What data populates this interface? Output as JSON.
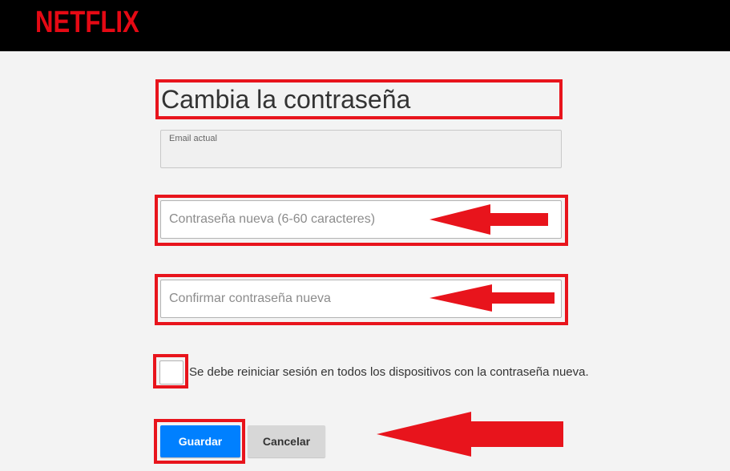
{
  "header": {
    "logo_text": "NETFLIX",
    "brand_color": "#e50914"
  },
  "form": {
    "title": "Cambia la contraseña",
    "email_label": "Email actual",
    "new_password_placeholder": "Contraseña nueva (6-60 caracteres)",
    "confirm_password_placeholder": "Confirmar contraseña nueva",
    "signout_checkbox_label": "Se debe reiniciar sesión en todos los dispositivos con la contraseña nueva.",
    "signout_checked": false,
    "save_label": "Guardar",
    "cancel_label": "Cancelar"
  },
  "annotations": {
    "highlight_color": "#e8141c",
    "arrow_color": "#e8141c",
    "arrow_icon": "arrow-left-icon"
  }
}
